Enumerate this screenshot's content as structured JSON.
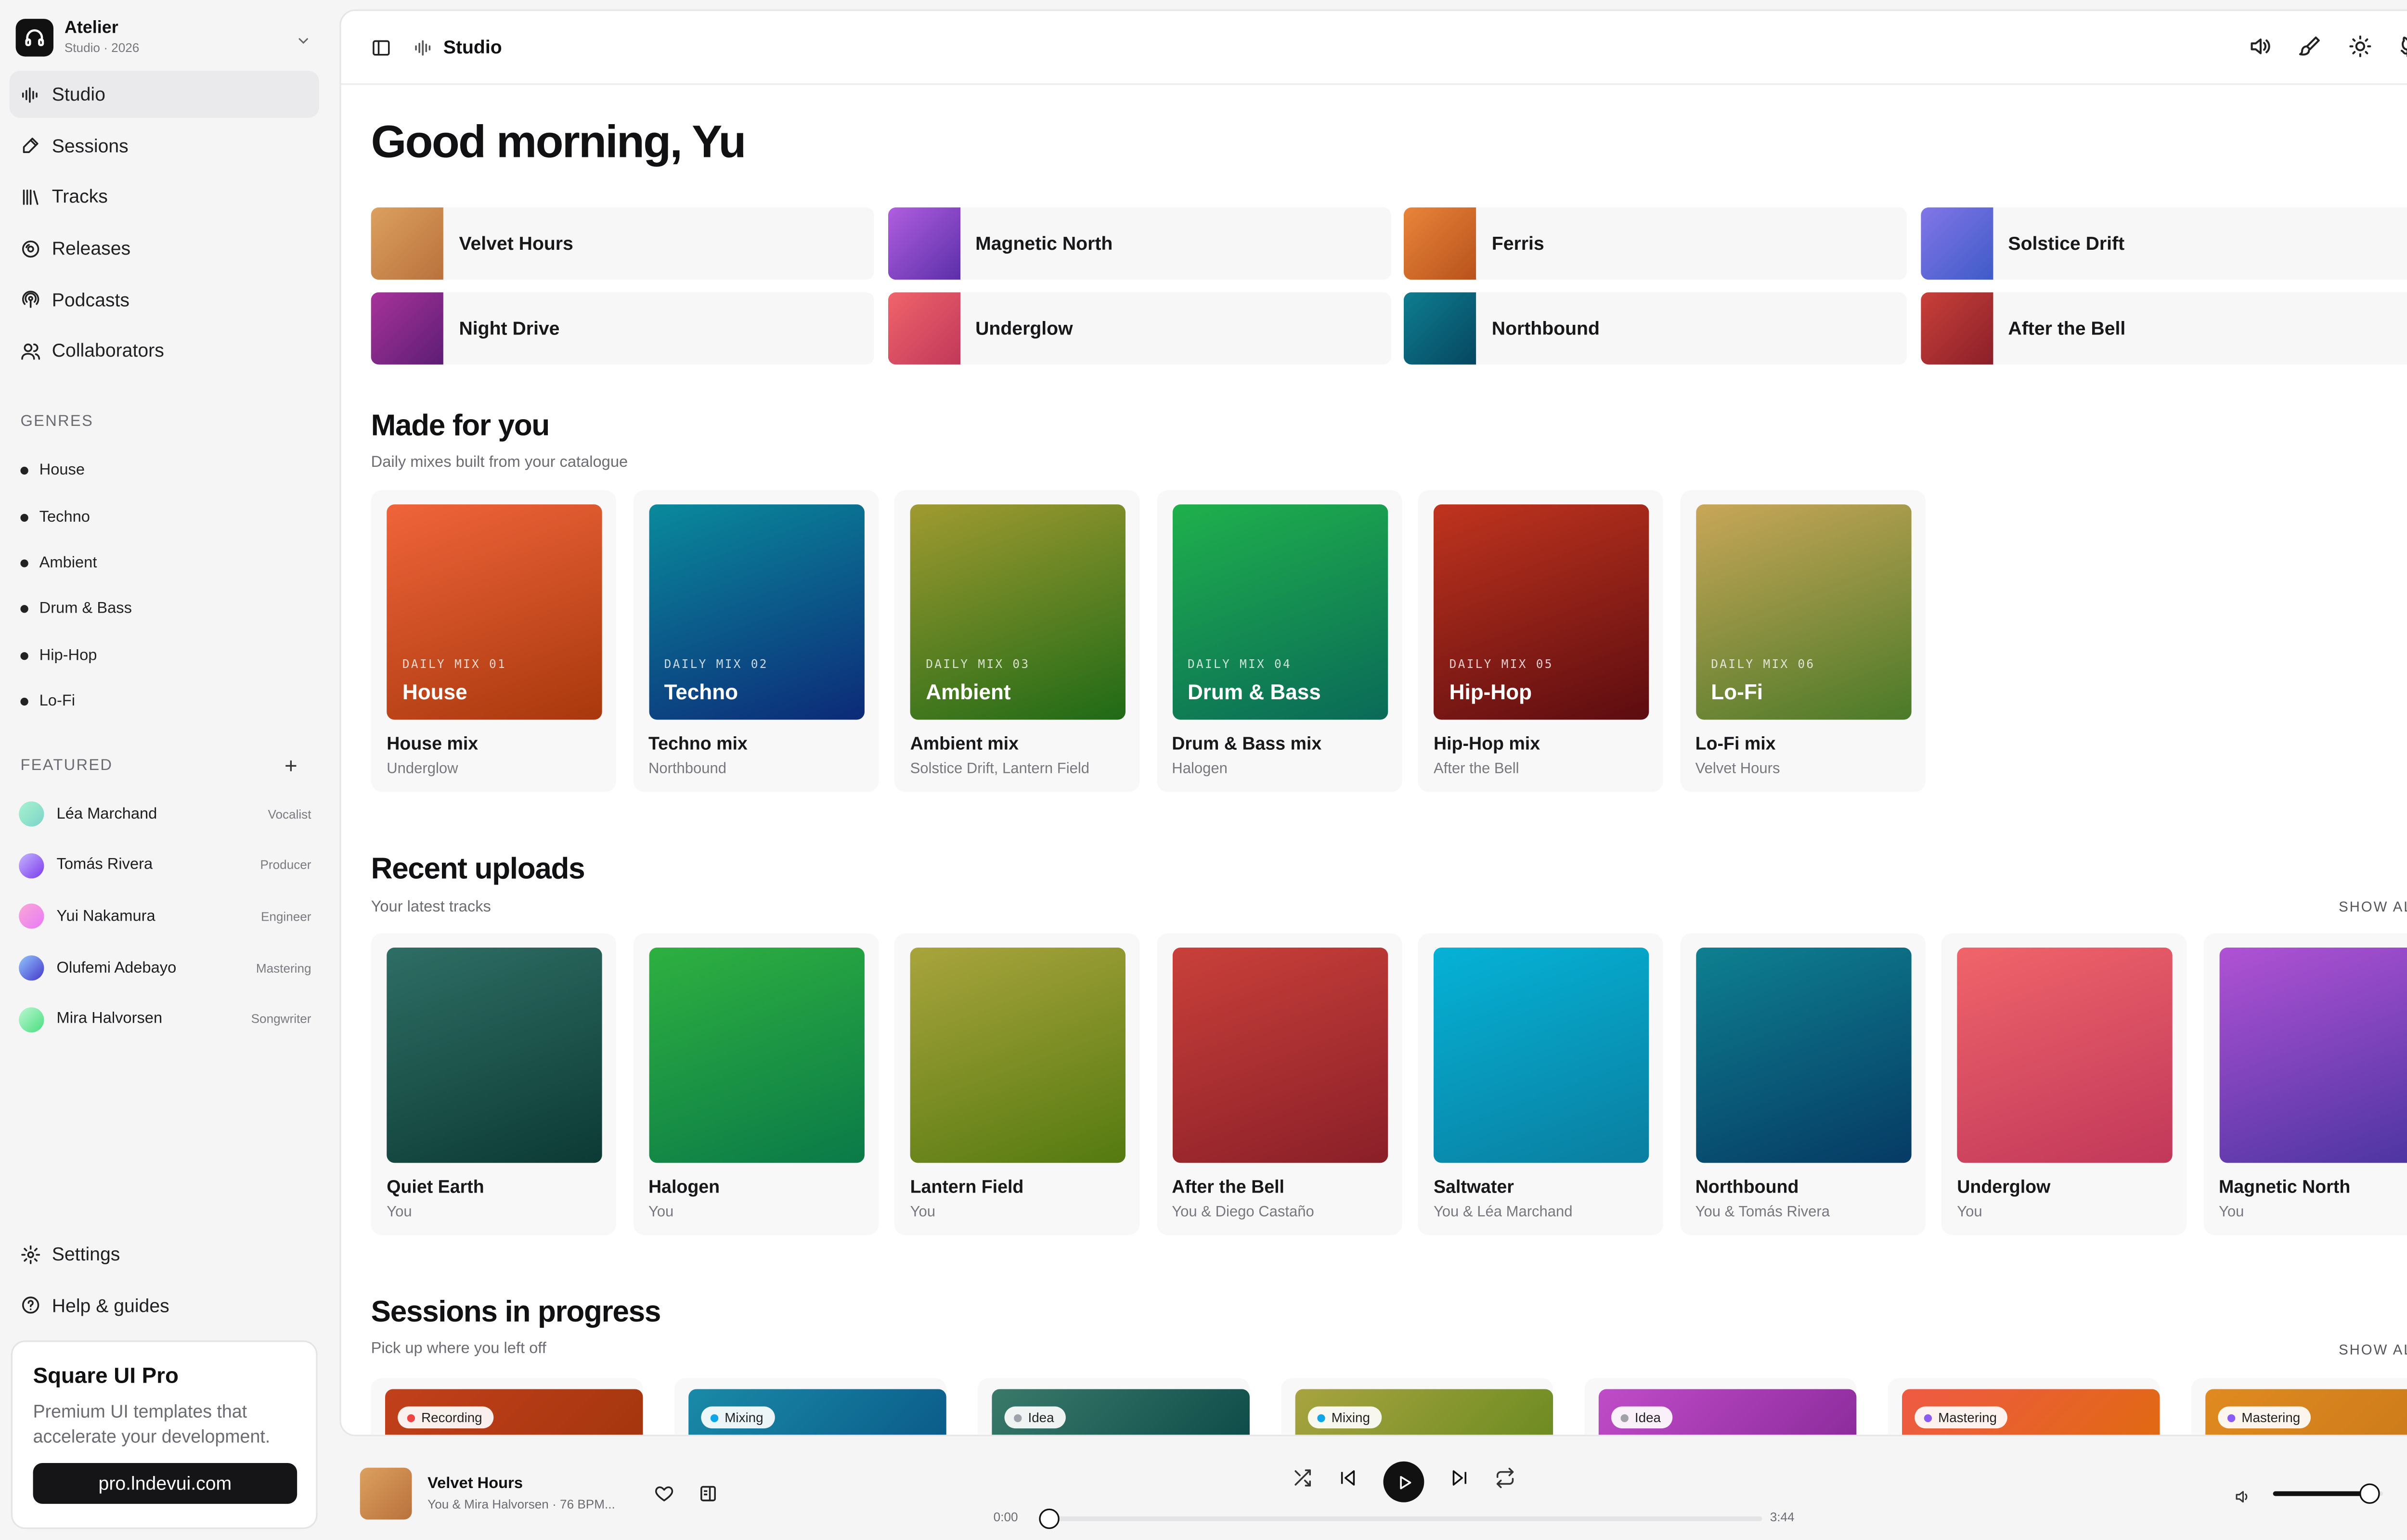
{
  "brand": {
    "name": "Atelier",
    "sub": "Studio · 2026"
  },
  "nav": [
    {
      "label": "Studio",
      "icon": "waveform-icon",
      "active": true
    },
    {
      "label": "Sessions",
      "icon": "pen-icon"
    },
    {
      "label": "Tracks",
      "icon": "library-icon"
    },
    {
      "label": "Releases",
      "icon": "disc-icon"
    },
    {
      "label": "Podcasts",
      "icon": "podcast-icon"
    },
    {
      "label": "Collaborators",
      "icon": "users-icon"
    }
  ],
  "genres_label": "GENRES",
  "genres": [
    "House",
    "Techno",
    "Ambient",
    "Drum & Bass",
    "Hip-Hop",
    "Lo-Fi"
  ],
  "featured_label": "FEATURED",
  "featured_add": "+",
  "people": [
    {
      "name": "Léa Marchand",
      "role": "Vocalist",
      "color1": "#a7f3d0",
      "color2": "#7dd3c8"
    },
    {
      "name": "Tomás Rivera",
      "role": "Producer",
      "color1": "#c4b5fd",
      "color2": "#7c3aed"
    },
    {
      "name": "Yui Nakamura",
      "role": "Engineer",
      "color1": "#f9a8d4",
      "color2": "#e879f9"
    },
    {
      "name": "Olufemi Adebayo",
      "role": "Mastering",
      "color1": "#93c5fd",
      "color2": "#4338ca"
    },
    {
      "name": "Mira Halvorsen",
      "role": "Songwriter",
      "color1": "#bbf7d0",
      "color2": "#4ade80"
    }
  ],
  "bottom_nav": [
    {
      "label": "Settings",
      "icon": "gear-icon"
    },
    {
      "label": "Help & guides",
      "icon": "help-icon"
    }
  ],
  "promo": {
    "title": "Square UI Pro",
    "desc": "Premium UI templates that accelerate your development.",
    "button": "pro.lndevui.com"
  },
  "topbar": {
    "crumb": "Studio"
  },
  "greeting": "Good morning, Yu",
  "quick": [
    {
      "label": "Velvet Hours",
      "c1": "#dca05f",
      "c2": "#b9713c"
    },
    {
      "label": "Magnetic North",
      "c1": "#b15ee0",
      "c2": "#5b2fa8"
    },
    {
      "label": "Ferris",
      "c1": "#e8853a",
      "c2": "#b8521c"
    },
    {
      "label": "Solstice Drift",
      "c1": "#8376e8",
      "c2": "#3e5bc7"
    },
    {
      "label": "Night Drive",
      "c1": "#a8339a",
      "c2": "#5c1d75"
    },
    {
      "label": "Underglow",
      "c1": "#f0646a",
      "c2": "#c1385a"
    },
    {
      "label": "Northbound",
      "c1": "#0e7e90",
      "c2": "#064660"
    },
    {
      "label": "After the Bell",
      "c1": "#c9403a",
      "c2": "#8a1f28"
    }
  ],
  "made_for_you": {
    "title": "Made for you",
    "sub": "Daily mixes built from your catalogue",
    "cards": [
      {
        "mix_no": "DAILY MIX 01",
        "mix_name": "House",
        "title": "House mix",
        "sub": "Underglow",
        "c1": "#f0643a",
        "c2": "#a8380c"
      },
      {
        "mix_no": "DAILY MIX 02",
        "mix_name": "Techno",
        "title": "Techno mix",
        "sub": "Northbound",
        "c1": "#0a8a9c",
        "c2": "#0c2a78"
      },
      {
        "mix_no": "DAILY MIX 03",
        "mix_name": "Ambient",
        "title": "Ambient mix",
        "sub": "Solstice Drift, Lantern Field",
        "c1": "#a09a30",
        "c2": "#1f6a16"
      },
      {
        "mix_no": "DAILY MIX 04",
        "mix_name": "Drum & Bass",
        "title": "Drum & Bass mix",
        "sub": "Halogen",
        "c1": "#1fb04c",
        "c2": "#0a6a58"
      },
      {
        "mix_no": "DAILY MIX 05",
        "mix_name": "Hip-Hop",
        "title": "Hip-Hop mix",
        "sub": "After the Bell",
        "c1": "#c0341e",
        "c2": "#5c0c10"
      },
      {
        "mix_no": "DAILY MIX 06",
        "mix_name": "Lo-Fi",
        "title": "Lo-Fi mix",
        "sub": "Velvet Hours",
        "c1": "#c9a658",
        "c2": "#4a7a28"
      }
    ]
  },
  "recent": {
    "title": "Recent uploads",
    "sub": "Your latest tracks",
    "show_all": "SHOW ALL",
    "cards": [
      {
        "title": "Quiet Earth",
        "sub": "You",
        "c1": "#2e6e64",
        "c2": "#0c3a34"
      },
      {
        "title": "Halogen",
        "sub": "You",
        "c1": "#2eb040",
        "c2": "#0a7a48"
      },
      {
        "title": "Lantern Field",
        "sub": "You",
        "c1": "#a9a43c",
        "c2": "#547a10"
      },
      {
        "title": "After the Bell",
        "sub": "You & Diego Castaño",
        "c1": "#c9403a",
        "c2": "#8a1f28"
      },
      {
        "title": "Saltwater",
        "sub": "You & Léa Marchand",
        "c1": "#05b2d6",
        "c2": "#0a7ea0"
      },
      {
        "title": "Northbound",
        "sub": "You & Tomás Rivera",
        "c1": "#0e8090",
        "c2": "#063a64"
      },
      {
        "title": "Underglow",
        "sub": "You",
        "c1": "#f0646a",
        "c2": "#c1385a"
      },
      {
        "title": "Magnetic North",
        "sub": "You",
        "c1": "#b052d4",
        "c2": "#4a34a0"
      }
    ]
  },
  "sessions": {
    "title": "Sessions in progress",
    "sub": "Pick up where you left off",
    "show_all": "SHOW ALL",
    "items": [
      {
        "status": "Recording",
        "dot": "#ef4444",
        "c1": "#c2401c",
        "c2": "#a3350c"
      },
      {
        "status": "Mixing",
        "dot": "#0ea5e9",
        "c1": "#1a8aa8",
        "c2": "#0a5a88"
      },
      {
        "status": "Idea",
        "dot": "#a1a1aa",
        "c1": "#3a7a6a",
        "c2": "#0c4a48"
      },
      {
        "status": "Mixing",
        "dot": "#0ea5e9",
        "c1": "#a8a440",
        "c2": "#6a8a20"
      },
      {
        "status": "Idea",
        "dot": "#a1a1aa",
        "c1": "#c04cc8",
        "c2": "#8a2a9a"
      },
      {
        "status": "Mastering",
        "dot": "#8b5cf6",
        "c1": "#ef5a44",
        "c2": "#e06a10"
      },
      {
        "status": "Mastering",
        "dot": "#8b5cf6",
        "c1": "#e08a20",
        "c2": "#c8781a"
      }
    ]
  },
  "player": {
    "title": "Velvet Hours",
    "sub": "You & Mira Halvorsen · 76 BPM...",
    "elapsed": "0:00",
    "duration": "3:44",
    "progress": 0,
    "volume": 0.87
  }
}
